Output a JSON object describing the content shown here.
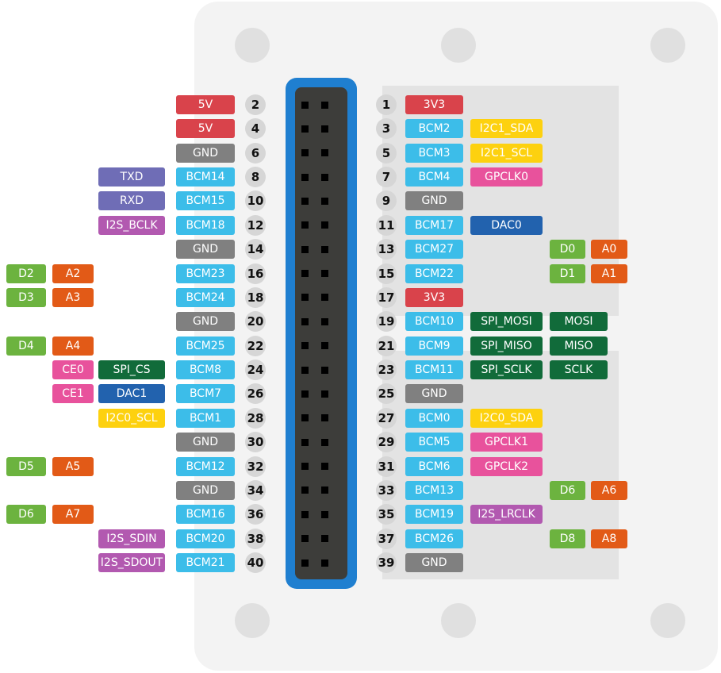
{
  "colors": {
    "red": "#d9434b",
    "blue": "#3cbde9",
    "gray": "#808080",
    "purple": "#6f6db6",
    "magenta": "#b259b0",
    "green": "#6cb33f",
    "orange": "#e25a17",
    "yellow": "#fdd10f",
    "pink": "#e8529c",
    "darkblue": "#2262ae",
    "darkgreen": "#116b3a",
    "header": "#1f7fd0"
  },
  "left": [
    {
      "pin": "2",
      "labels": [
        {
          "text": "5V",
          "color": "red",
          "slot": "main"
        }
      ]
    },
    {
      "pin": "4",
      "labels": [
        {
          "text": "5V",
          "color": "red",
          "slot": "main"
        }
      ]
    },
    {
      "pin": "6",
      "labels": [
        {
          "text": "GND",
          "color": "gray",
          "slot": "main"
        }
      ]
    },
    {
      "pin": "8",
      "labels": [
        {
          "text": "BCM14",
          "color": "blue",
          "slot": "main"
        },
        {
          "text": "TXD",
          "color": "purple",
          "slot": "fn"
        }
      ]
    },
    {
      "pin": "10",
      "labels": [
        {
          "text": "BCM15",
          "color": "blue",
          "slot": "main"
        },
        {
          "text": "RXD",
          "color": "purple",
          "slot": "fn"
        }
      ]
    },
    {
      "pin": "12",
      "labels": [
        {
          "text": "BCM18",
          "color": "blue",
          "slot": "main"
        },
        {
          "text": "I2S_BCLK",
          "color": "magenta",
          "slot": "fn"
        }
      ]
    },
    {
      "pin": "14",
      "labels": [
        {
          "text": "GND",
          "color": "gray",
          "slot": "main"
        }
      ]
    },
    {
      "pin": "16",
      "labels": [
        {
          "text": "BCM23",
          "color": "blue",
          "slot": "main"
        },
        {
          "text": "D2",
          "color": "green",
          "slot": "d"
        },
        {
          "text": "A2",
          "color": "orange",
          "slot": "a"
        }
      ]
    },
    {
      "pin": "18",
      "labels": [
        {
          "text": "BCM24",
          "color": "blue",
          "slot": "main"
        },
        {
          "text": "D3",
          "color": "green",
          "slot": "d"
        },
        {
          "text": "A3",
          "color": "orange",
          "slot": "a"
        }
      ]
    },
    {
      "pin": "20",
      "labels": [
        {
          "text": "GND",
          "color": "gray",
          "slot": "main"
        }
      ]
    },
    {
      "pin": "22",
      "labels": [
        {
          "text": "BCM25",
          "color": "blue",
          "slot": "main"
        },
        {
          "text": "D4",
          "color": "green",
          "slot": "d"
        },
        {
          "text": "A4",
          "color": "orange",
          "slot": "a"
        }
      ]
    },
    {
      "pin": "24",
      "labels": [
        {
          "text": "BCM8",
          "color": "blue",
          "slot": "main"
        },
        {
          "text": "SPI_CS",
          "color": "darkgreen",
          "slot": "fn"
        },
        {
          "text": "CE0",
          "color": "pink",
          "slot": "a"
        }
      ]
    },
    {
      "pin": "26",
      "labels": [
        {
          "text": "BCM7",
          "color": "blue",
          "slot": "main"
        },
        {
          "text": "DAC1",
          "color": "darkblue",
          "slot": "fn"
        },
        {
          "text": "CE1",
          "color": "pink",
          "slot": "a"
        }
      ]
    },
    {
      "pin": "28",
      "labels": [
        {
          "text": "BCM1",
          "color": "blue",
          "slot": "main"
        },
        {
          "text": "I2C0_SCL",
          "color": "yellow",
          "slot": "fn"
        }
      ]
    },
    {
      "pin": "30",
      "labels": [
        {
          "text": "GND",
          "color": "gray",
          "slot": "main"
        }
      ]
    },
    {
      "pin": "32",
      "labels": [
        {
          "text": "BCM12",
          "color": "blue",
          "slot": "main"
        },
        {
          "text": "D5",
          "color": "green",
          "slot": "d"
        },
        {
          "text": "A5",
          "color": "orange",
          "slot": "a"
        }
      ]
    },
    {
      "pin": "34",
      "labels": [
        {
          "text": "GND",
          "color": "gray",
          "slot": "main"
        }
      ]
    },
    {
      "pin": "36",
      "labels": [
        {
          "text": "BCM16",
          "color": "blue",
          "slot": "main"
        },
        {
          "text": "D6",
          "color": "green",
          "slot": "d"
        },
        {
          "text": "A7",
          "color": "orange",
          "slot": "a"
        }
      ]
    },
    {
      "pin": "38",
      "labels": [
        {
          "text": "BCM20",
          "color": "blue",
          "slot": "main"
        },
        {
          "text": "I2S_SDIN",
          "color": "magenta",
          "slot": "fn"
        }
      ]
    },
    {
      "pin": "40",
      "labels": [
        {
          "text": "BCM21",
          "color": "blue",
          "slot": "main"
        },
        {
          "text": "I2S_SDOUT",
          "color": "magenta",
          "slot": "fn"
        }
      ]
    }
  ],
  "right": [
    {
      "pin": "1",
      "labels": [
        {
          "text": "3V3",
          "color": "red",
          "slot": "main"
        }
      ]
    },
    {
      "pin": "3",
      "labels": [
        {
          "text": "BCM2",
          "color": "blue",
          "slot": "main"
        },
        {
          "text": "I2C1_SDA",
          "color": "yellow",
          "slot": "fn"
        }
      ]
    },
    {
      "pin": "5",
      "labels": [
        {
          "text": "BCM3",
          "color": "blue",
          "slot": "main"
        },
        {
          "text": "I2C1_SCL",
          "color": "yellow",
          "slot": "fn"
        }
      ]
    },
    {
      "pin": "7",
      "labels": [
        {
          "text": "BCM4",
          "color": "blue",
          "slot": "main"
        },
        {
          "text": "GPCLK0",
          "color": "pink",
          "slot": "fn"
        }
      ]
    },
    {
      "pin": "9",
      "labels": [
        {
          "text": "GND",
          "color": "gray",
          "slot": "main"
        }
      ]
    },
    {
      "pin": "11",
      "labels": [
        {
          "text": "BCM17",
          "color": "blue",
          "slot": "main"
        },
        {
          "text": "DAC0",
          "color": "darkblue",
          "slot": "fn"
        }
      ]
    },
    {
      "pin": "13",
      "labels": [
        {
          "text": "BCM27",
          "color": "blue",
          "slot": "main"
        },
        {
          "text": "D0",
          "color": "green",
          "slot": "d"
        },
        {
          "text": "A0",
          "color": "orange",
          "slot": "a"
        }
      ]
    },
    {
      "pin": "15",
      "labels": [
        {
          "text": "BCM22",
          "color": "blue",
          "slot": "main"
        },
        {
          "text": "D1",
          "color": "green",
          "slot": "d"
        },
        {
          "text": "A1",
          "color": "orange",
          "slot": "a"
        }
      ]
    },
    {
      "pin": "17",
      "labels": [
        {
          "text": "3V3",
          "color": "red",
          "slot": "main"
        }
      ]
    },
    {
      "pin": "19",
      "labels": [
        {
          "text": "BCM10",
          "color": "blue",
          "slot": "main"
        },
        {
          "text": "SPI_MOSI",
          "color": "darkgreen",
          "slot": "fn"
        },
        {
          "text": "MOSI",
          "color": "darkgreen",
          "slot": "wide"
        }
      ]
    },
    {
      "pin": "21",
      "labels": [
        {
          "text": "BCM9",
          "color": "blue",
          "slot": "main"
        },
        {
          "text": "SPI_MISO",
          "color": "darkgreen",
          "slot": "fn"
        },
        {
          "text": "MISO",
          "color": "darkgreen",
          "slot": "wide"
        }
      ]
    },
    {
      "pin": "23",
      "labels": [
        {
          "text": "BCM11",
          "color": "blue",
          "slot": "main"
        },
        {
          "text": "SPI_SCLK",
          "color": "darkgreen",
          "slot": "fn"
        },
        {
          "text": "SCLK",
          "color": "darkgreen",
          "slot": "wide"
        }
      ]
    },
    {
      "pin": "25",
      "labels": [
        {
          "text": "GND",
          "color": "gray",
          "slot": "main"
        }
      ]
    },
    {
      "pin": "27",
      "labels": [
        {
          "text": "BCM0",
          "color": "blue",
          "slot": "main"
        },
        {
          "text": "I2C0_SDA",
          "color": "yellow",
          "slot": "fn"
        }
      ]
    },
    {
      "pin": "29",
      "labels": [
        {
          "text": "BCM5",
          "color": "blue",
          "slot": "main"
        },
        {
          "text": "GPCLK1",
          "color": "pink",
          "slot": "fn"
        }
      ]
    },
    {
      "pin": "31",
      "labels": [
        {
          "text": "BCM6",
          "color": "blue",
          "slot": "main"
        },
        {
          "text": "GPCLK2",
          "color": "pink",
          "slot": "fn"
        }
      ]
    },
    {
      "pin": "33",
      "labels": [
        {
          "text": "BCM13",
          "color": "blue",
          "slot": "main"
        },
        {
          "text": "D6",
          "color": "green",
          "slot": "d"
        },
        {
          "text": "A6",
          "color": "orange",
          "slot": "a"
        }
      ]
    },
    {
      "pin": "35",
      "labels": [
        {
          "text": "BCM19",
          "color": "blue",
          "slot": "main"
        },
        {
          "text": "I2S_LRCLK",
          "color": "magenta",
          "slot": "fn"
        }
      ]
    },
    {
      "pin": "37",
      "labels": [
        {
          "text": "BCM26",
          "color": "blue",
          "slot": "main"
        },
        {
          "text": "D8",
          "color": "green",
          "slot": "d"
        },
        {
          "text": "A8",
          "color": "orange",
          "slot": "a"
        }
      ]
    },
    {
      "pin": "39",
      "labels": [
        {
          "text": "GND",
          "color": "gray",
          "slot": "main"
        }
      ]
    }
  ]
}
